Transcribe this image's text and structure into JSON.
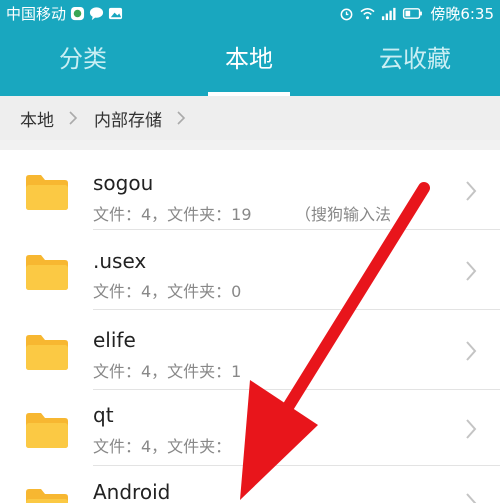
{
  "status_bar": {
    "carrier": "中国移动",
    "time_label": "傍晚6:35",
    "icons": [
      "app-icon",
      "chat-icon",
      "image-icon",
      "alarm-icon",
      "wifi-icon",
      "signal-icon",
      "battery-icon"
    ]
  },
  "tabs": [
    {
      "label": "分类",
      "active": false
    },
    {
      "label": "本地",
      "active": true
    },
    {
      "label": "云收藏",
      "active": false
    }
  ],
  "breadcrumb": [
    "本地",
    "内部存储"
  ],
  "folders": [
    {
      "name": "sogou",
      "meta": "文件：4，文件夹：19",
      "note": "（搜狗输入法"
    },
    {
      "name": ".usex",
      "meta": "文件：4，文件夹：0"
    },
    {
      "name": "elife",
      "meta": "文件：4，文件夹：1"
    },
    {
      "name": "qt",
      "meta": "文件：4，文件夹："
    },
    {
      "name": "Android",
      "meta": ""
    }
  ],
  "colors": {
    "header": "#19a7bf",
    "folder": "#f7b731",
    "arrow": "#e8151b"
  }
}
